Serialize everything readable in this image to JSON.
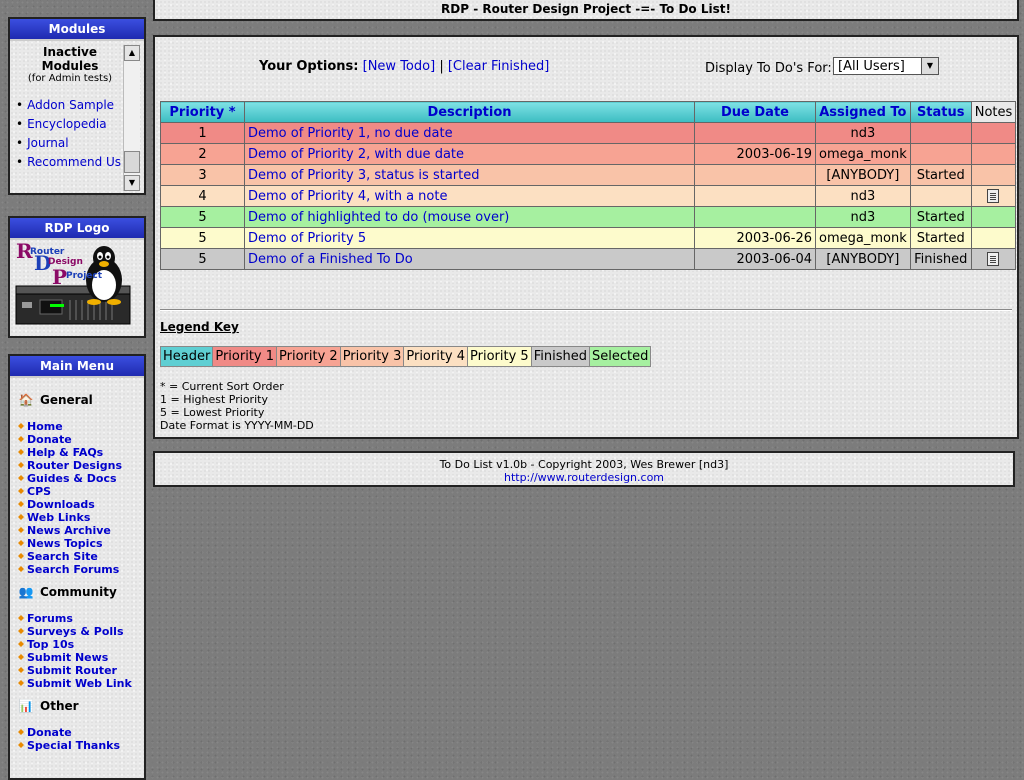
{
  "site_title": "RDP - Router Design Project -=- To Do List!",
  "modules": {
    "title": "Modules",
    "heading_line1": "Inactive",
    "heading_line2": "Modules",
    "subheading": "(for Admin tests)",
    "items": [
      "Addon Sample",
      "Encyclopedia",
      "Journal",
      "Recommend Us"
    ]
  },
  "logo_box": {
    "title": "RDP Logo",
    "logo_word1": "Router",
    "logo_word2": "Design",
    "logo_word3": "Project",
    "logo_initials": "RDP"
  },
  "main_menu": {
    "title": "Main Menu",
    "categories": [
      {
        "label": "General",
        "icon": "home-icon",
        "items": [
          "Home",
          "Donate",
          "Help & FAQs",
          "Router Designs",
          "Guides & Docs",
          "CPS",
          "Downloads",
          "Web Links",
          "News Archive",
          "News Topics",
          "Search Site",
          "Search Forums"
        ]
      },
      {
        "label": "Community",
        "icon": "users-icon",
        "items": [
          "Forums",
          "Surveys & Polls",
          "Top 10s",
          "Submit News",
          "Submit Router",
          "Submit Web Link"
        ]
      },
      {
        "label": "Other",
        "icon": "bar-chart-icon",
        "items": [
          "Donate",
          "Special Thanks"
        ]
      }
    ]
  },
  "options": {
    "label": "Your Options:",
    "new_todo": "[New Todo]",
    "separator": "|",
    "clear_finished": "[Clear Finished]",
    "display_label": "Display To Do's For:",
    "display_value": "[All Users]"
  },
  "table": {
    "headers": [
      "Priority *",
      "Description",
      "Due Date",
      "Assigned To",
      "Status",
      "Notes"
    ],
    "rows": [
      {
        "priority": "1",
        "description": "Demo of Priority 1, no due date",
        "due": "",
        "assigned": "nd3",
        "status": "",
        "note": false,
        "bg": "#f08a86"
      },
      {
        "priority": "2",
        "description": "Demo of Priority 2, with due date",
        "due": "2003-06-19",
        "assigned": "omega_monk",
        "status": "",
        "note": false,
        "bg": "#f7a393"
      },
      {
        "priority": "3",
        "description": "Demo of Priority 3, status is started",
        "due": "",
        "assigned": "[ANYBODY]",
        "status": "Started",
        "note": false,
        "bg": "#f9c3a8"
      },
      {
        "priority": "4",
        "description": "Demo of Priority 4, with a note",
        "due": "",
        "assigned": "nd3",
        "status": "",
        "note": true,
        "bg": "#fce0c2"
      },
      {
        "priority": "5",
        "description": "Demo of highlighted to do (mouse over)",
        "due": "",
        "assigned": "nd3",
        "status": "Started",
        "note": false,
        "bg": "#a6f0a0"
      },
      {
        "priority": "5",
        "description": "Demo of Priority 5",
        "due": "2003-06-26",
        "assigned": "omega_monk",
        "status": "Started",
        "note": false,
        "bg": "#fdfbcc"
      },
      {
        "priority": "5",
        "description": "Demo of a Finished To Do",
        "due": "2003-06-04",
        "assigned": "[ANYBODY]",
        "status": "Finished",
        "note": true,
        "bg": "#c9c9c9"
      }
    ]
  },
  "legend": {
    "title": "Legend Key",
    "keys": [
      {
        "label": "Header",
        "color": "#5fcfd3"
      },
      {
        "label": "Priority 1",
        "color": "#f08a86"
      },
      {
        "label": "Priority 2",
        "color": "#f7a393"
      },
      {
        "label": "Priority 3",
        "color": "#f9c3a8"
      },
      {
        "label": "Priority 4",
        "color": "#fce0c2"
      },
      {
        "label": "Priority 5",
        "color": "#fdfbcc"
      },
      {
        "label": "Finished",
        "color": "#c9c9c9"
      },
      {
        "label": "Selected",
        "color": "#a6f0a0"
      }
    ],
    "notes": [
      "* = Current Sort Order",
      "1 = Highest Priority",
      "5 = Lowest Priority",
      "Date Format is YYYY-MM-DD"
    ]
  },
  "footer": {
    "line1": "To Do List v1.0b - Copyright 2003, Wes Brewer [nd3]",
    "url": "http://www.routerdesign.com"
  }
}
